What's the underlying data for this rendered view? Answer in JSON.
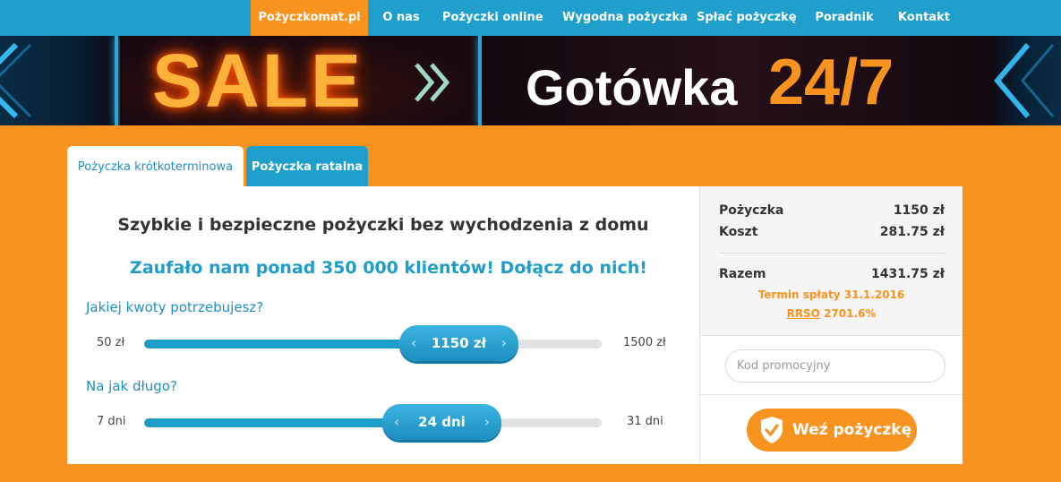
{
  "nav": {
    "items": [
      "Pożyczkomat.pl",
      "O nas",
      "Pożyczki online",
      "Wygodna pożyczka",
      "Spłać pożyczkę",
      "Poradnik",
      "Kontakt"
    ]
  },
  "banner": {
    "sale": "SALE",
    "gotowka": "Gotówka",
    "hours": "24/7"
  },
  "tabs": {
    "short": "Pożyczka krótkoterminowa",
    "installment": "Pożyczka ratalna"
  },
  "calculator": {
    "headline": "Szybkie i bezpieczne pożyczki bez wychodzenia z domu",
    "subline": "Zaufało nam ponad 350 000 klientów! Dołącz do nich!",
    "amount": {
      "question": "Jakiej kwoty potrzebujesz?",
      "min": "50 zł",
      "max": "1500 zł",
      "value": "1150 zł",
      "fraction": 0.69
    },
    "duration": {
      "question": "Na jak długo?",
      "min": "7 dni",
      "max": "31 dni",
      "value": "24 dni",
      "fraction": 0.65
    }
  },
  "summary": {
    "loan_label": "Pożyczka",
    "loan_value": "1150 zł",
    "cost_label": "Koszt",
    "cost_value": "281.75 zł",
    "total_label": "Razem",
    "total_value": "1431.75 zł",
    "due_label": "Termin spłaty",
    "due_date": "31.1.2016",
    "rrso_label": "RRSO",
    "rrso_value": "2701.6%",
    "promo_placeholder": "Kod promocyjny",
    "button": "Weź pożyczkę"
  },
  "colors": {
    "orange": "#f7931e",
    "blue": "#1fa0cc"
  }
}
